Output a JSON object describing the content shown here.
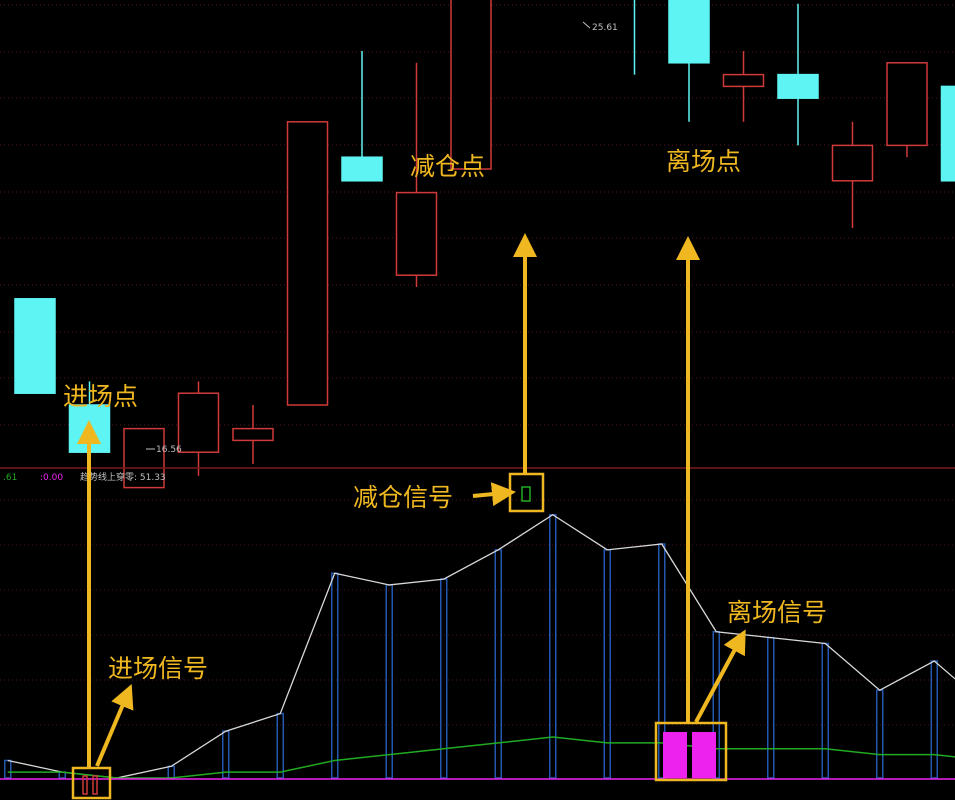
{
  "chart_data": {
    "type": "candlestick",
    "candles": [
      {
        "o": 21.5,
        "h": 21.5,
        "l": 20.7,
        "c": 20.7
      },
      {
        "o": 20.6,
        "h": 20.8,
        "l": 20.0,
        "c": 20.2
      },
      {
        "o": 19.9,
        "h": 20.4,
        "l": 19.9,
        "c": 20.4
      },
      {
        "o": 20.2,
        "h": 20.8,
        "l": 20.0,
        "c": 20.7
      },
      {
        "o": 20.3,
        "h": 20.6,
        "l": 20.1,
        "c": 20.4
      },
      {
        "o": 20.6,
        "h": 23.0,
        "l": 20.6,
        "c": 23.0
      },
      {
        "o": 22.7,
        "h": 23.6,
        "l": 22.6,
        "c": 22.5
      },
      {
        "o": 21.7,
        "h": 23.5,
        "l": 21.6,
        "c": 22.4
      },
      {
        "o": 22.6,
        "h": 24.6,
        "l": 22.6,
        "c": 24.1
      },
      {
        "o": 24.6,
        "h": 26.1,
        "l": 24.2,
        "c": 26.1
      },
      {
        "o": 25.6,
        "h": 27.1,
        "l": 24.8,
        "c": 25.0
      },
      {
        "o": 24.6,
        "h": 25.1,
        "l": 23.4,
        "c": 24.3
      },
      {
        "o": 24.7,
        "h": 24.7,
        "l": 23.0,
        "c": 23.5
      },
      {
        "o": 23.3,
        "h": 23.6,
        "l": 23.0,
        "c": 23.4
      },
      {
        "o": 23.4,
        "h": 24.0,
        "l": 22.8,
        "c": 23.2
      },
      {
        "o": 22.5,
        "h": 23.0,
        "l": 22.1,
        "c": 22.8
      },
      {
        "o": 22.8,
        "h": 23.5,
        "l": 22.7,
        "c": 23.5
      },
      {
        "o": 23.3,
        "h": 23.3,
        "l": 22.5,
        "c": 22.5
      }
    ],
    "price_labels": {
      "high": "25.61",
      "low": "16.56"
    },
    "indicator": {
      "line": [
        3,
        1,
        0,
        2,
        8,
        11,
        35,
        33,
        34,
        39,
        45,
        39,
        40,
        25,
        24,
        23,
        15,
        20,
        12
      ],
      "baseline": [
        1,
        1,
        0,
        0,
        1,
        1,
        3,
        4,
        5,
        6,
        7,
        6,
        6,
        5,
        5,
        5,
        4,
        4,
        3
      ],
      "legend_values": [
        ".61",
        ":0.00"
      ],
      "legend_text": "趋势线上穿零: 51.33"
    }
  },
  "annotations": {
    "entry_point": "进场点",
    "reduce_point": "减仓点",
    "exit_point": "离场点",
    "entry_signal": "进场信号",
    "reduce_signal": "减仓信号",
    "exit_signal": "离场信号"
  },
  "colors": {
    "up": "#d03a3a",
    "down": "#5ff4f4",
    "annotation": "#f0b820",
    "indicator_bar": "#2458b0",
    "indicator_line": "#d8d8d8",
    "baseline_green": "#22aa22",
    "magenta": "#ee22ee",
    "divider": "#7a1a1a"
  }
}
